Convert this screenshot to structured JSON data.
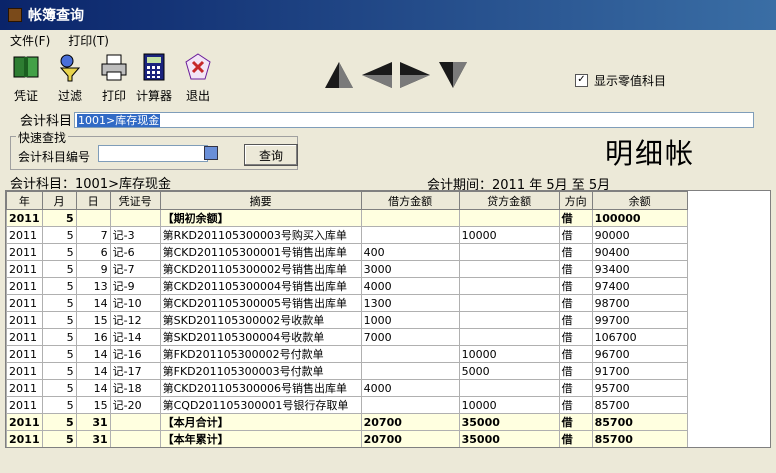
{
  "window": {
    "title": "帐簿查询"
  },
  "menu": [
    "文件(F)",
    "打印(T)"
  ],
  "toolbar": {
    "voucher": "凭证",
    "filter": "过滤",
    "print": "打印",
    "calculator": "计算器",
    "exit": "退出"
  },
  "show_zero_label": "显示零值科目",
  "account": {
    "label": "会计科目",
    "value": "1001>库存现金"
  },
  "quick_search": {
    "legend": "快速查找",
    "label": "会计科目编号",
    "button": "查询"
  },
  "big_title": "明细帐",
  "info": {
    "account_line": "会计科目：1001>库存现金",
    "period_line": "会计期间：2011 年 5月 至 5月"
  },
  "columns": [
    "年",
    "月",
    "日",
    "凭证号",
    "摘要",
    "借方金额",
    "贷方金额",
    "方向",
    "余额"
  ],
  "rows": [
    {
      "y": "2011",
      "m": "5",
      "d": "",
      "no": "",
      "desc": "【期初余额】",
      "debit": "",
      "credit": "",
      "dir": "借",
      "bal": "100000",
      "sum": true
    },
    {
      "y": "2011",
      "m": "5",
      "d": "7",
      "no": "记-3",
      "desc": "第RKD201105300003号购买入库单",
      "debit": "",
      "credit": "10000",
      "dir": "借",
      "bal": "90000",
      "sum": false
    },
    {
      "y": "2011",
      "m": "5",
      "d": "6",
      "no": "记-6",
      "desc": "第CKD201105300001号销售出库单",
      "debit": "400",
      "credit": "",
      "dir": "借",
      "bal": "90400",
      "sum": false
    },
    {
      "y": "2011",
      "m": "5",
      "d": "9",
      "no": "记-7",
      "desc": "第CKD201105300002号销售出库单",
      "debit": "3000",
      "credit": "",
      "dir": "借",
      "bal": "93400",
      "sum": false
    },
    {
      "y": "2011",
      "m": "5",
      "d": "13",
      "no": "记-9",
      "desc": "第CKD201105300004号销售出库单",
      "debit": "4000",
      "credit": "",
      "dir": "借",
      "bal": "97400",
      "sum": false
    },
    {
      "y": "2011",
      "m": "5",
      "d": "14",
      "no": "记-10",
      "desc": "第CKD201105300005号销售出库单",
      "debit": "1300",
      "credit": "",
      "dir": "借",
      "bal": "98700",
      "sum": false
    },
    {
      "y": "2011",
      "m": "5",
      "d": "15",
      "no": "记-12",
      "desc": "第SKD201105300002号收款单",
      "debit": "1000",
      "credit": "",
      "dir": "借",
      "bal": "99700",
      "sum": false
    },
    {
      "y": "2011",
      "m": "5",
      "d": "16",
      "no": "记-14",
      "desc": "第SKD201105300004号收款单",
      "debit": "7000",
      "credit": "",
      "dir": "借",
      "bal": "106700",
      "sum": false
    },
    {
      "y": "2011",
      "m": "5",
      "d": "14",
      "no": "记-16",
      "desc": "第FKD201105300002号付款单",
      "debit": "",
      "credit": "10000",
      "dir": "借",
      "bal": "96700",
      "sum": false
    },
    {
      "y": "2011",
      "m": "5",
      "d": "14",
      "no": "记-17",
      "desc": "第FKD201105300003号付款单",
      "debit": "",
      "credit": "5000",
      "dir": "借",
      "bal": "91700",
      "sum": false
    },
    {
      "y": "2011",
      "m": "5",
      "d": "14",
      "no": "记-18",
      "desc": "第CKD201105300006号销售出库单",
      "debit": "4000",
      "credit": "",
      "dir": "借",
      "bal": "95700",
      "sum": false
    },
    {
      "y": "2011",
      "m": "5",
      "d": "15",
      "no": "记-20",
      "desc": "第CQD201105300001号银行存取单",
      "debit": "",
      "credit": "10000",
      "dir": "借",
      "bal": "85700",
      "sum": false
    },
    {
      "y": "2011",
      "m": "5",
      "d": "31",
      "no": "",
      "desc": "【本月合计】",
      "debit": "20700",
      "credit": "35000",
      "dir": "借",
      "bal": "85700",
      "sum": true
    },
    {
      "y": "2011",
      "m": "5",
      "d": "31",
      "no": "",
      "desc": "【本年累计】",
      "debit": "20700",
      "credit": "35000",
      "dir": "借",
      "bal": "85700",
      "sum": true
    }
  ]
}
